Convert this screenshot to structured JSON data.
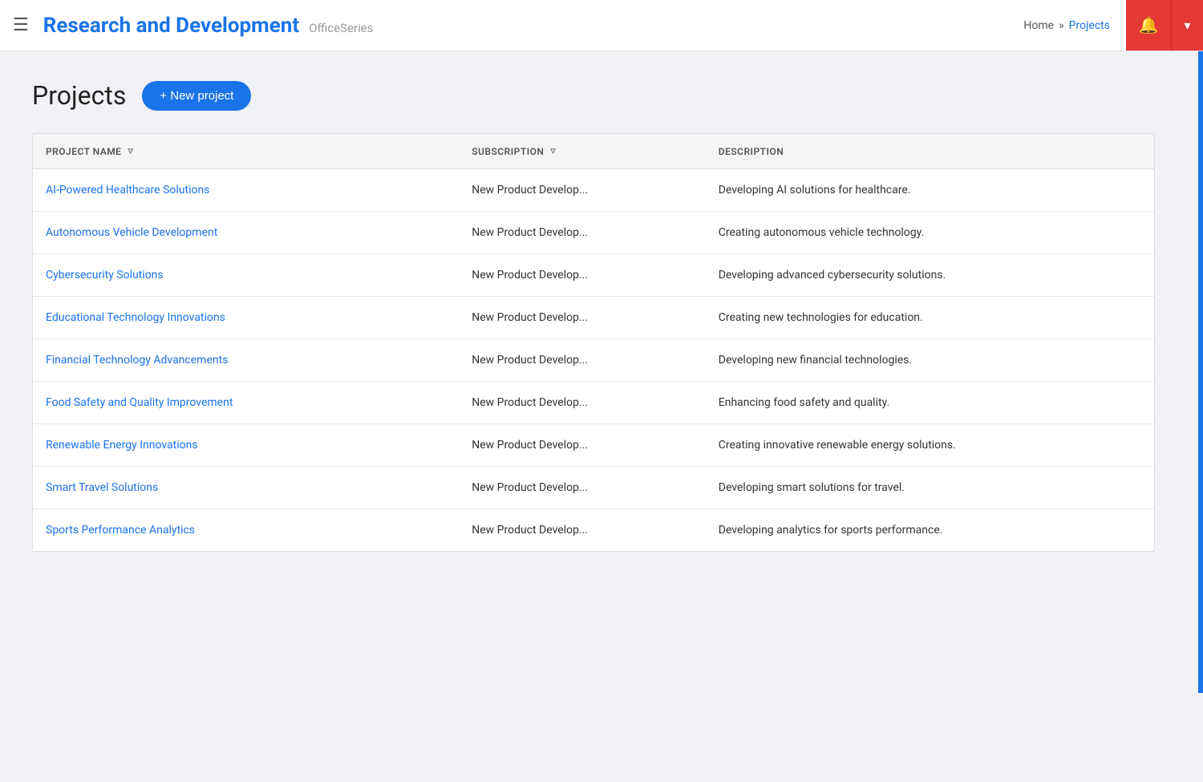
{
  "header": {
    "menu_label": "Menu",
    "title": "Research and Development",
    "subtitle": "OfficeSeries",
    "nav_home": "Home",
    "nav_separator": "»",
    "nav_current": "Projects",
    "bell_icon": "🔔",
    "dropdown_icon": "▾"
  },
  "page": {
    "heading": "Projects",
    "new_project_btn": "+ New project"
  },
  "table": {
    "columns": [
      {
        "key": "name",
        "label": "PROJECT NAME"
      },
      {
        "key": "subscription",
        "label": "SUBSCRIPTION"
      },
      {
        "key": "description",
        "label": "DESCRIPTION"
      }
    ],
    "rows": [
      {
        "name": "AI-Powered Healthcare Solutions",
        "subscription": "New Product Develop...",
        "description": "Developing AI solutions for healthcare."
      },
      {
        "name": "Autonomous Vehicle Development",
        "subscription": "New Product Develop...",
        "description": "Creating autonomous vehicle technology."
      },
      {
        "name": "Cybersecurity Solutions",
        "subscription": "New Product Develop...",
        "description": "Developing advanced cybersecurity solutions."
      },
      {
        "name": "Educational Technology Innovations",
        "subscription": "New Product Develop...",
        "description": "Creating new technologies for education."
      },
      {
        "name": "Financial Technology Advancements",
        "subscription": "New Product Develop...",
        "description": "Developing new financial technologies."
      },
      {
        "name": "Food Safety and Quality Improvement",
        "subscription": "New Product Develop...",
        "description": "Enhancing food safety and quality."
      },
      {
        "name": "Renewable Energy Innovations",
        "subscription": "New Product Develop...",
        "description": "Creating innovative renewable energy solutions."
      },
      {
        "name": "Smart Travel Solutions",
        "subscription": "New Product Develop...",
        "description": "Developing smart solutions for travel."
      },
      {
        "name": "Sports Performance Analytics",
        "subscription": "New Product Develop...",
        "description": "Developing analytics for sports performance."
      }
    ]
  }
}
